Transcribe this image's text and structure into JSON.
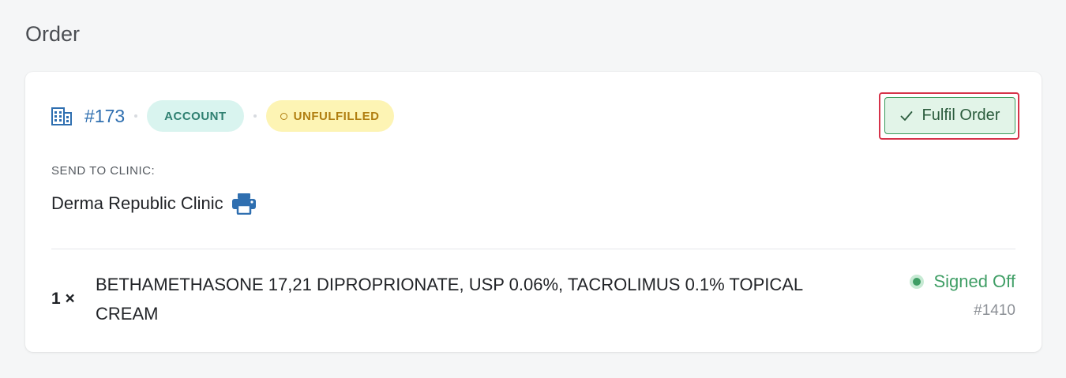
{
  "page": {
    "title": "Order"
  },
  "order": {
    "number": "#173",
    "account_badge": "ACCOUNT",
    "status_badge": "UNFULFILLED",
    "fulfil_button_label": "Fulfil Order",
    "send_to_label": "SEND TO CLINIC:",
    "clinic_name": "Derma Republic Clinic",
    "items": [
      {
        "quantity": "1 ×",
        "name": "BETHAMETHASONE 17,21 DIPROPRIONATE, USP 0.06%, TACROLIMUS 0.1% TOPICAL CREAM",
        "status": "Signed Off",
        "id": "#1410"
      }
    ]
  },
  "colors": {
    "accent_blue": "#2f6fb0",
    "account_badge_bg": "#d9f4ef",
    "unfulfilled_badge_bg": "#fdf4b4",
    "success_green": "#3f9e65",
    "highlight_red": "#d6334a"
  },
  "icons": {
    "order_icon": "building-icon",
    "print_icon": "printer-icon",
    "button_icon": "check-icon",
    "status_icon": "status-dot-icon"
  }
}
